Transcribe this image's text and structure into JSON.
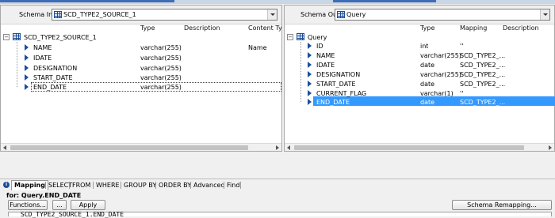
{
  "schema_in": {
    "label": "Schema In:",
    "value": "SCD_TYPE2_SOURCE_1",
    "columns": [
      "Type",
      "Description",
      "Content Typ"
    ],
    "root": "SCD_TYPE2_SOURCE_1",
    "rows": [
      {
        "name": "NAME",
        "type": "varchar(255)",
        "description": "",
        "content_type": "Name"
      },
      {
        "name": "IDATE",
        "type": "varchar(255)",
        "description": "",
        "content_type": ""
      },
      {
        "name": "DESIGNATION",
        "type": "varchar(255)",
        "description": "",
        "content_type": ""
      },
      {
        "name": "START_DATE",
        "type": "varchar(255)",
        "description": "",
        "content_type": ""
      },
      {
        "name": "END_DATE",
        "type": "varchar(255)",
        "description": "",
        "content_type": ""
      }
    ]
  },
  "schema_out": {
    "label": "Schema Out:",
    "value": "Query",
    "columns": [
      "Type",
      "Mapping",
      "Description"
    ],
    "root": "Query",
    "rows": [
      {
        "name": "ID",
        "type": "int",
        "mapping": "''"
      },
      {
        "name": "NAME",
        "type": "varchar(255)",
        "mapping": "SCD_TYPE2_..."
      },
      {
        "name": "IDATE",
        "type": "date",
        "mapping": "SCD_TYPE2_..."
      },
      {
        "name": "DESIGNATION",
        "type": "varchar(255)",
        "mapping": "SCD_TYPE2_..."
      },
      {
        "name": "START_DATE",
        "type": "date",
        "mapping": "SCD_TYPE2_..."
      },
      {
        "name": "CURRENT_FLAG",
        "type": "varchar(1)",
        "mapping": "''"
      },
      {
        "name": "END_DATE",
        "type": "date",
        "mapping": "SCD_TYPE2_..."
      }
    ]
  },
  "tabs": [
    "Mapping",
    "SELECT",
    "FROM",
    "WHERE",
    "GROUP BY",
    "ORDER BY",
    "Advanced",
    "Find"
  ],
  "mapping_panel": {
    "for_label": "for: Query.END_DATE",
    "functions_button": "Functions...",
    "ellipsis_button": "...",
    "apply_button": "Apply",
    "schema_remapping_button": "Schema Remapping...",
    "expression": "SCD_TYPE2_SOURCE_1.END_DATE"
  },
  "colors": {
    "selection": "#3399ff",
    "arrow_icon": "#1a4f9c",
    "table_icon": "#1b4e96"
  }
}
